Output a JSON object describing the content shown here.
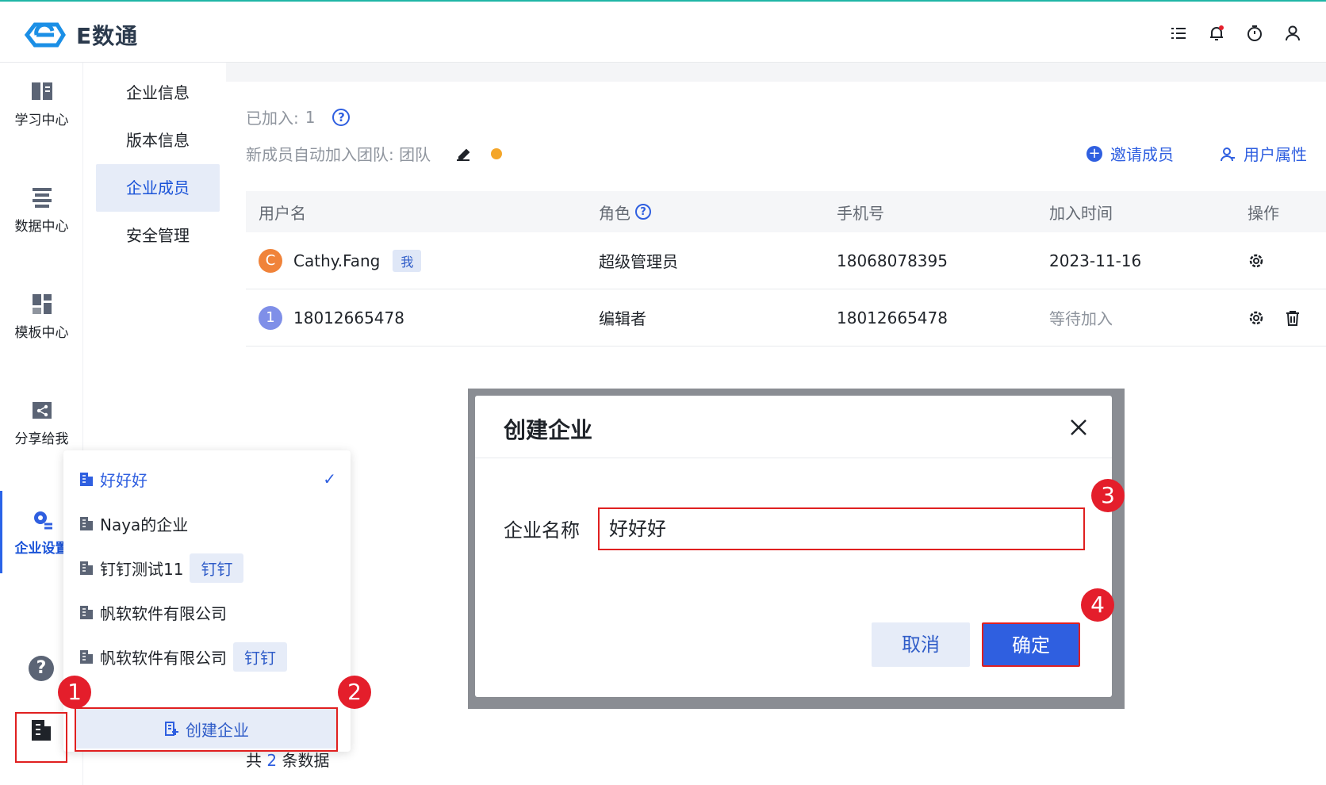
{
  "app": {
    "logo_text": "E数通"
  },
  "leftnav": [
    {
      "label": "学习中心",
      "icon": "book-icon"
    },
    {
      "label": "数据中心",
      "icon": "database-icon"
    },
    {
      "label": "模板中心",
      "icon": "template-icon"
    },
    {
      "label": "分享给我",
      "icon": "share-icon"
    },
    {
      "label": "企业设置",
      "icon": "enterprise-settings-icon"
    }
  ],
  "submenu": [
    "企业信息",
    "版本信息",
    "企业成员",
    "安全管理"
  ],
  "members": {
    "joined_label": "已加入:",
    "joined_count": "1",
    "auto_join": "新成员自动加入团队: 团队",
    "invite": "邀请成员",
    "user_attr": "用户属性",
    "columns": [
      "用户名",
      "角色",
      "手机号",
      "加入时间",
      "操作"
    ],
    "rows": [
      {
        "avatar": "C",
        "name": "Cathy.Fang",
        "tag": "我",
        "role": "超级管理员",
        "phone": "18068078395",
        "time": "2023-11-16",
        "avatar_color": "#f0833a"
      },
      {
        "avatar": "1",
        "name": "18012665478",
        "tag": "",
        "role": "编辑者",
        "phone": "18012665478",
        "time": "等待加入",
        "avatar_color": "#7f8fe8"
      }
    ],
    "total_prefix": "共",
    "total_count": "2",
    "total_suffix": "条数据"
  },
  "dropdown": {
    "items": [
      {
        "name": "好好好",
        "tag": "",
        "selected": true
      },
      {
        "name": "Naya的企业",
        "tag": ""
      },
      {
        "name": "钉钉测试11",
        "tag": "钉钉"
      },
      {
        "name": "帆软软件有限公司",
        "tag": ""
      },
      {
        "name": "帆软软件有限公司",
        "tag": "钉钉"
      }
    ],
    "create_label": "创建企业"
  },
  "modal": {
    "title": "创建企业",
    "field_label": "企业名称",
    "field_value": "好好好",
    "cancel": "取消",
    "ok": "确定"
  },
  "badges": [
    "1",
    "2",
    "3",
    "4"
  ],
  "colors": {
    "accent": "#2f5fe0",
    "marker": "#e41e2b"
  }
}
